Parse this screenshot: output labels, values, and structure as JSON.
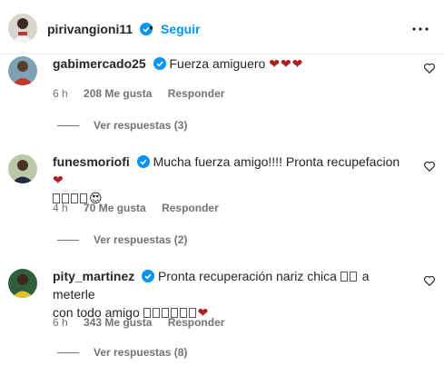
{
  "header": {
    "username": "pirivangioni11",
    "separator": "•",
    "follow_label": "Seguir"
  },
  "comments": [
    {
      "username": "gabimercado25",
      "text": "Fuerza amiguero ",
      "hearts": "❤❤❤",
      "time": "6 h",
      "likes": "208 Me gusta",
      "reply_label": "Responder",
      "view_replies": "Ver respuestas (3)"
    },
    {
      "username": "funesmoriofi",
      "text": "Mucha fuerza amigo!!!! Pronta recupefacion",
      "hearts": "❤",
      "emoji": "😍",
      "time": "4 h",
      "likes": "70 Me gusta",
      "reply_label": "Responder",
      "view_replies": "Ver respuestas (2)"
    },
    {
      "username": "pity_martinez",
      "text": "Pronta recuperación nariz chica",
      "text2": "a meterle",
      "text3": "con todo amigo",
      "hearts": "❤",
      "time": "6 h",
      "likes": "343 Me gusta",
      "reply_label": "Responder",
      "view_replies": "Ver respuestas (8)"
    }
  ],
  "colors": {
    "link_blue": "#0095f6",
    "verified_blue": "#0095f6",
    "heart_red": "#b0201e",
    "meta_gray": "#737373"
  },
  "icons": {
    "verified": "verified-badge-icon",
    "more": "more-options-icon",
    "like": "heart-outline-icon"
  }
}
